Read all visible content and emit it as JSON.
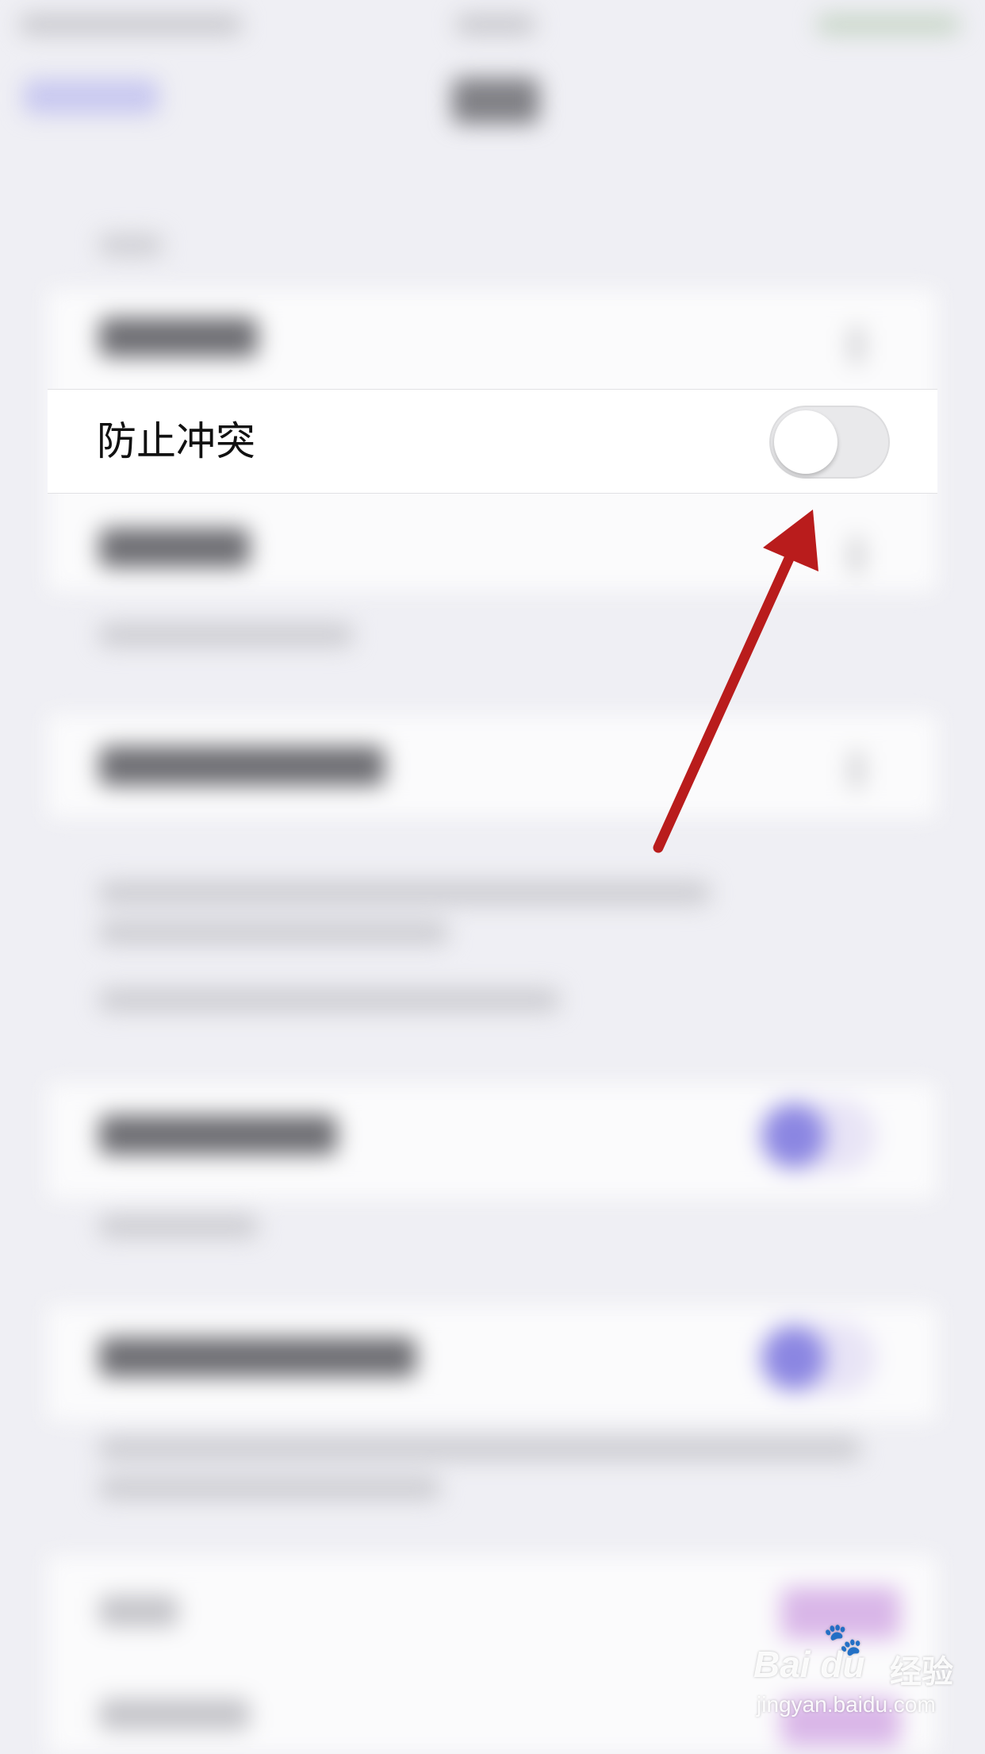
{
  "setting_row": {
    "label": "防止冲突",
    "toggle_state": "off"
  },
  "watermark": {
    "brand": "Bai du",
    "paw": "🐾",
    "cn": "经验",
    "url": "jingyan.baidu.com"
  },
  "colors": {
    "background": "#efeff4",
    "card": "#ffffff",
    "toggle_on": "#8b86e2",
    "toggle_off": "#e9e9eb",
    "arrow": "#b91c1c"
  }
}
